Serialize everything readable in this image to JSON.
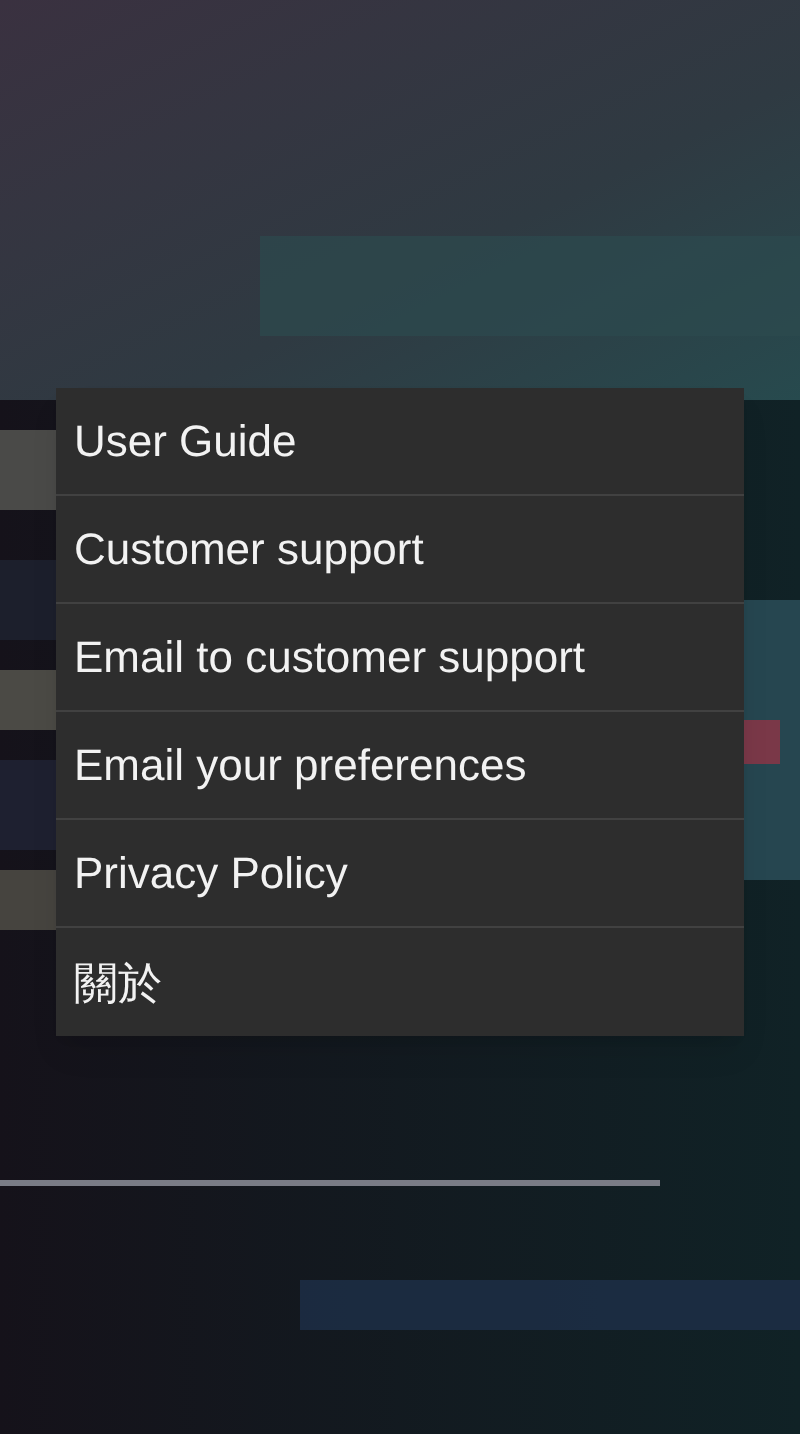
{
  "menu": {
    "items": [
      {
        "label": "User Guide"
      },
      {
        "label": "Customer support"
      },
      {
        "label": "Email to customer support"
      },
      {
        "label": "Email your preferences"
      },
      {
        "label": "Privacy Policy"
      },
      {
        "label": "關於"
      }
    ]
  }
}
